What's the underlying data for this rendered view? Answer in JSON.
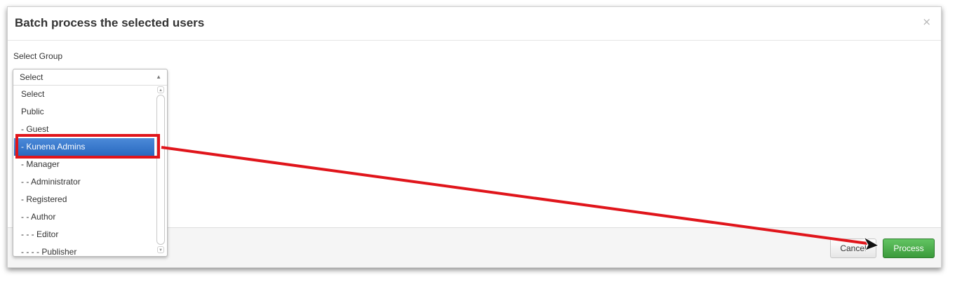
{
  "dialog": {
    "title": "Batch process the selected users",
    "close_symbol": "×"
  },
  "form": {
    "group_label": "Select Group"
  },
  "select": {
    "value": "Select",
    "arrow_icon": "chevron-up-icon",
    "options": [
      "Select",
      "Public",
      "- Guest",
      "- Kunena Admins",
      "- Manager",
      "- - Administrator",
      "- Registered",
      "- - Author",
      "- - - Editor",
      "- - - - Publisher"
    ],
    "highlighted_index": 3
  },
  "footer": {
    "cancel_label": "Cancel",
    "process_label": "Process"
  },
  "annotation": {
    "color": "#e0151b",
    "pointer_icon": "mouse-cursor-icon"
  },
  "colors": {
    "process_button": "#3f9f3f",
    "highlight": "#2a69c0"
  }
}
